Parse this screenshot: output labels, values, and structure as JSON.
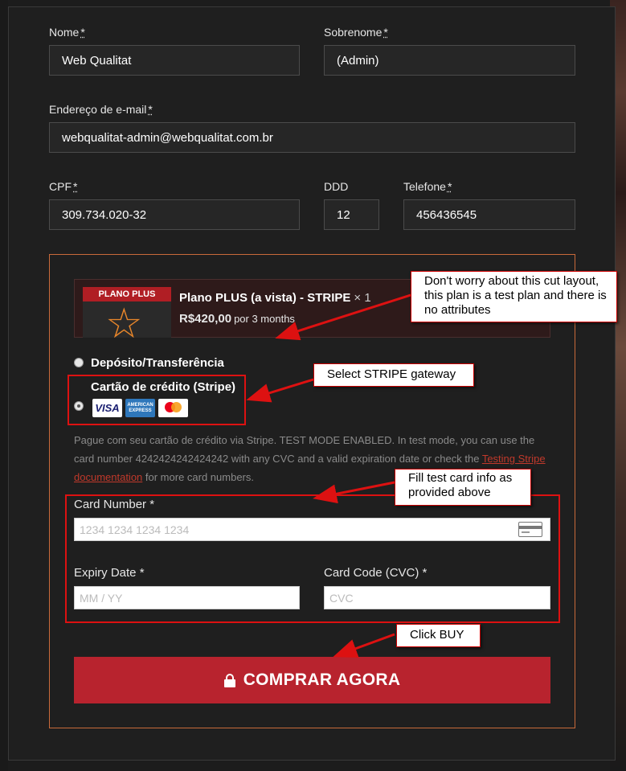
{
  "form": {
    "first_name_label": "Nome",
    "first_name_value": "Web Qualitat",
    "last_name_label": "Sobrenome",
    "last_name_value": "(Admin)",
    "email_label": "Endereço de e-mail",
    "email_value": "webqualitat-admin@webqualitat.com.br",
    "cpf_label": "CPF",
    "cpf_value": "309.734.020-32",
    "ddd_label": "DDD",
    "ddd_value": "12",
    "phone_label": "Telefone",
    "phone_value": "456436545",
    "required_mark": "*"
  },
  "order": {
    "thumb_banner": "PLANO PLUS",
    "product_name": "Plano PLUS (a vista) - STRIPE",
    "quantity": "× 1",
    "price": "R$420,00",
    "period": "por 3 months"
  },
  "payment": {
    "option_transfer": "Depósito/Transferência",
    "option_stripe": "Cartão de crédito (Stripe)",
    "card_brands": [
      "VISA",
      "AMERICAN EXPRESS",
      "mastercard"
    ],
    "description_part1": "Pague com seu cartão de crédito via Stripe. TEST MODE ENABLED. In test mode, you can use the card number 4242424242424242 with any CVC and a valid expiration date or check the ",
    "description_link": "Testing Stripe documentation",
    "description_part2": " for more card numbers.",
    "card_number_label": "Card Number *",
    "card_number_placeholder": "1234 1234 1234 1234",
    "expiry_label": "Expiry Date *",
    "expiry_placeholder": "MM / YY",
    "cvc_label": "Card Code (CVC) *",
    "cvc_placeholder": "CVC"
  },
  "buy_button": "COMPRAR AGORA",
  "annotations": {
    "note_layout": "Don't worry about this cut layout, this plan is a test plan and there is no attributes",
    "note_gateway": "Select STRIPE gateway",
    "note_card": "Fill test card info as provided above",
    "note_buy": "Click BUY",
    "arrow_color": "#dd1111"
  }
}
